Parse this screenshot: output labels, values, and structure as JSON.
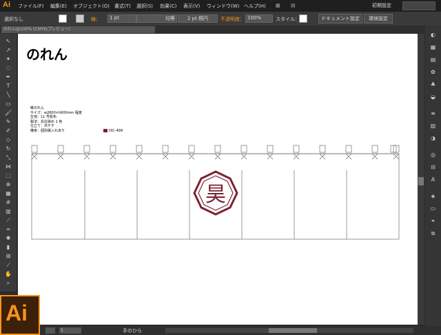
{
  "app": {
    "logo": "Ai",
    "menu": [
      "ファイル(F)",
      "編集(E)",
      "オブジェクト(O)",
      "書式(T)",
      "選択(S)",
      "効果(C)",
      "表示(V)",
      "ウィンドウ(W)",
      "ヘルプ(H)"
    ],
    "workspace": "初期設定",
    "accent_color": "#f7941d"
  },
  "control_bar": {
    "selection_label": "選択なし",
    "stroke_label": "線：",
    "stroke_weight": "1 pt",
    "stroke_profile": "均等",
    "brush": "2 pt 楕円",
    "opacity_label": "不透明度：",
    "opacity_value": "100%",
    "style_label": "スタイル：",
    "doc_setup_button": "ドキュメント設定",
    "prefs_button": "環境設定"
  },
  "document_tab": "のれん@100% (CMYK/プレビュー)",
  "artboard": {
    "title": "のれん",
    "specs": [
      "暖のれん",
      "サイズ：w2600×h600mm 程度",
      "生地：11 号帆布",
      "製法：反応染め 1 色",
      "仕立て：共チチ",
      "備考：個別袋入れあり"
    ],
    "color_chip": "DIC-499",
    "ink_color": "#7a2233",
    "logo_char": "昊"
  },
  "status_bar": {
    "zoom": "",
    "page": "1",
    "current_tool": "手のひら"
  },
  "app_badge": "Ai"
}
